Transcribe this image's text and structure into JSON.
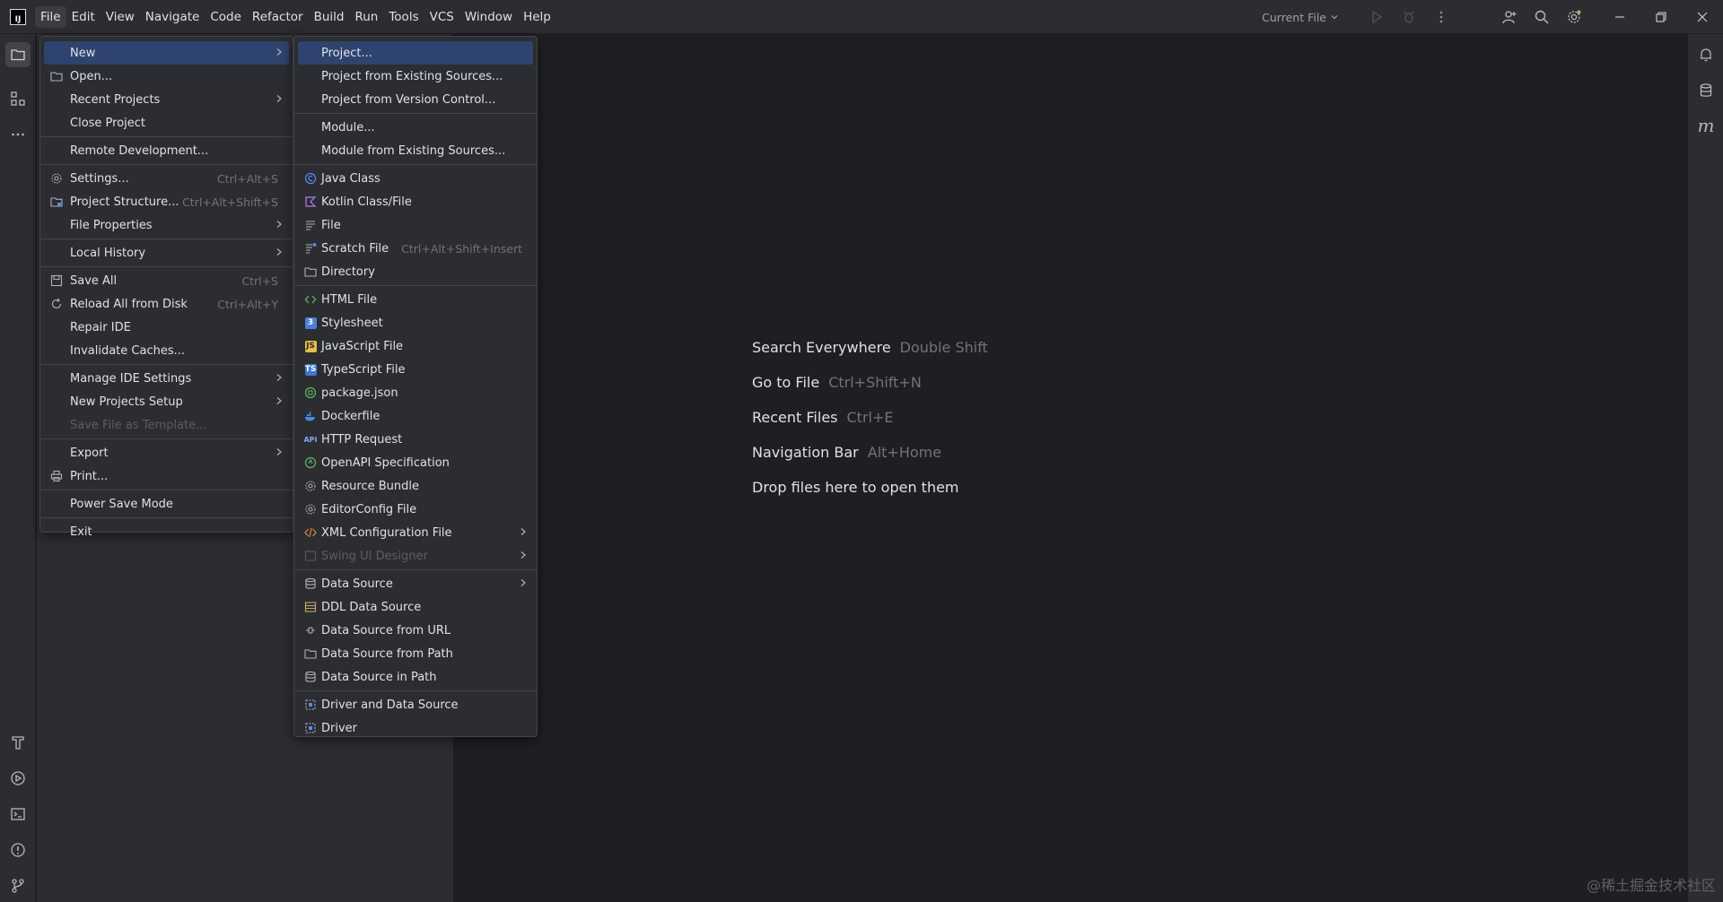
{
  "menubar": {
    "items": [
      "File",
      "Edit",
      "View",
      "Navigate",
      "Code",
      "Refactor",
      "Build",
      "Run",
      "Tools",
      "VCS",
      "Window",
      "Help"
    ]
  },
  "toolbar": {
    "run_config": "Current File"
  },
  "file_menu": [
    {
      "label": "New",
      "icon": "",
      "shortcut": "",
      "submenu": true,
      "selected": true
    },
    {
      "label": "Open...",
      "icon": "folder-icon",
      "shortcut": "",
      "submenu": false
    },
    {
      "label": "Recent Projects",
      "icon": "",
      "shortcut": "",
      "submenu": true
    },
    {
      "label": "Close Project",
      "icon": "",
      "shortcut": "",
      "submenu": false
    },
    {
      "sep": true
    },
    {
      "label": "Remote Development...",
      "icon": "",
      "shortcut": "",
      "submenu": false
    },
    {
      "sep": true
    },
    {
      "label": "Settings...",
      "icon": "gear-icon",
      "shortcut": "Ctrl+Alt+S",
      "submenu": false
    },
    {
      "label": "Project Structure...",
      "icon": "project-structure-icon",
      "shortcut": "Ctrl+Alt+Shift+S",
      "submenu": false
    },
    {
      "label": "File Properties",
      "icon": "",
      "shortcut": "",
      "submenu": true
    },
    {
      "sep": true
    },
    {
      "label": "Local History",
      "icon": "",
      "shortcut": "",
      "submenu": true
    },
    {
      "sep": true
    },
    {
      "label": "Save All",
      "icon": "save-icon",
      "shortcut": "Ctrl+S",
      "submenu": false
    },
    {
      "label": "Reload All from Disk",
      "icon": "reload-icon",
      "shortcut": "Ctrl+Alt+Y",
      "submenu": false
    },
    {
      "label": "Repair IDE",
      "icon": "",
      "shortcut": "",
      "submenu": false
    },
    {
      "label": "Invalidate Caches...",
      "icon": "",
      "shortcut": "",
      "submenu": false
    },
    {
      "sep": true
    },
    {
      "label": "Manage IDE Settings",
      "icon": "",
      "shortcut": "",
      "submenu": true
    },
    {
      "label": "New Projects Setup",
      "icon": "",
      "shortcut": "",
      "submenu": true
    },
    {
      "label": "Save File as Template...",
      "icon": "",
      "shortcut": "",
      "submenu": false,
      "disabled": true
    },
    {
      "sep": true
    },
    {
      "label": "Export",
      "icon": "",
      "shortcut": "",
      "submenu": true
    },
    {
      "label": "Print...",
      "icon": "print-icon",
      "shortcut": "",
      "submenu": false
    },
    {
      "sep": true
    },
    {
      "label": "Power Save Mode",
      "icon": "",
      "shortcut": "",
      "submenu": false
    },
    {
      "sep": true
    },
    {
      "label": "Exit",
      "icon": "",
      "shortcut": "",
      "submenu": false
    }
  ],
  "new_menu": [
    {
      "label": "Project...",
      "icon": "",
      "shortcut": "",
      "submenu": false,
      "selected": true
    },
    {
      "label": "Project from Existing Sources...",
      "icon": "",
      "shortcut": "",
      "submenu": false
    },
    {
      "label": "Project from Version Control...",
      "icon": "",
      "shortcut": "",
      "submenu": false
    },
    {
      "sep": true
    },
    {
      "label": "Module...",
      "icon": "",
      "shortcut": "",
      "submenu": false
    },
    {
      "label": "Module from Existing Sources...",
      "icon": "",
      "shortcut": "",
      "submenu": false
    },
    {
      "sep": true
    },
    {
      "label": "Java Class",
      "icon": "java-class-icon",
      "shortcut": "",
      "submenu": false
    },
    {
      "label": "Kotlin Class/File",
      "icon": "kotlin-icon",
      "shortcut": "",
      "submenu": false
    },
    {
      "label": "File",
      "icon": "file-icon",
      "shortcut": "",
      "submenu": false
    },
    {
      "label": "Scratch File",
      "icon": "scratch-file-icon",
      "shortcut": "Ctrl+Alt+Shift+Insert",
      "submenu": false
    },
    {
      "label": "Directory",
      "icon": "folder-icon",
      "shortcut": "",
      "submenu": false
    },
    {
      "sep": true
    },
    {
      "label": "HTML File",
      "icon": "html-icon",
      "shortcut": "",
      "submenu": false
    },
    {
      "label": "Stylesheet",
      "icon": "css-icon",
      "shortcut": "",
      "submenu": false
    },
    {
      "label": "JavaScript File",
      "icon": "javascript-icon",
      "shortcut": "",
      "submenu": false
    },
    {
      "label": "TypeScript File",
      "icon": "typescript-icon",
      "shortcut": "",
      "submenu": false
    },
    {
      "label": "package.json",
      "icon": "package-json-icon",
      "shortcut": "",
      "submenu": false
    },
    {
      "label": "Dockerfile",
      "icon": "docker-icon",
      "shortcut": "",
      "submenu": false
    },
    {
      "label": "HTTP Request",
      "icon": "api-icon",
      "shortcut": "",
      "submenu": false
    },
    {
      "label": "OpenAPI Specification",
      "icon": "openapi-icon",
      "shortcut": "",
      "submenu": false
    },
    {
      "label": "Resource Bundle",
      "icon": "resource-bundle-icon",
      "shortcut": "",
      "submenu": false
    },
    {
      "label": "EditorConfig File",
      "icon": "editorconfig-icon",
      "shortcut": "",
      "submenu": false
    },
    {
      "label": "XML Configuration File",
      "icon": "xml-icon",
      "shortcut": "",
      "submenu": true
    },
    {
      "label": "Swing UI Designer",
      "icon": "swing-icon",
      "shortcut": "",
      "submenu": true,
      "disabled": true
    },
    {
      "sep": true
    },
    {
      "label": "Data Source",
      "icon": "database-icon",
      "shortcut": "",
      "submenu": true
    },
    {
      "label": "DDL Data Source",
      "icon": "ddl-icon",
      "shortcut": "",
      "submenu": false
    },
    {
      "label": "Data Source from URL",
      "icon": "url-icon",
      "shortcut": "",
      "submenu": false
    },
    {
      "label": "Data Source from Path",
      "icon": "folder-icon",
      "shortcut": "",
      "submenu": false
    },
    {
      "label": "Data Source in Path",
      "icon": "database-icon",
      "shortcut": "",
      "submenu": false
    },
    {
      "sep": true
    },
    {
      "label": "Driver and Data Source",
      "icon": "driver-icon",
      "shortcut": "",
      "submenu": false
    },
    {
      "label": "Driver",
      "icon": "driver-icon",
      "shortcut": "",
      "submenu": false
    }
  ],
  "editor_hints": [
    {
      "action": "Search Everywhere",
      "shortcut": "Double Shift"
    },
    {
      "action": "Go to File",
      "shortcut": "Ctrl+Shift+N"
    },
    {
      "action": "Recent Files",
      "shortcut": "Ctrl+E"
    },
    {
      "action": "Navigation Bar",
      "shortcut": "Alt+Home"
    },
    {
      "action": "Drop files here to open them",
      "shortcut": ""
    }
  ],
  "right_strip": {
    "m_label": "m"
  },
  "app_logo": {
    "label": "IJ"
  },
  "watermark": "@稀土掘金技术社区",
  "colors": {
    "background": "#1e1f22",
    "panel": "#2b2d30",
    "selection": "#2e436e",
    "text": "#dfe1e5",
    "muted": "#6f737a"
  }
}
